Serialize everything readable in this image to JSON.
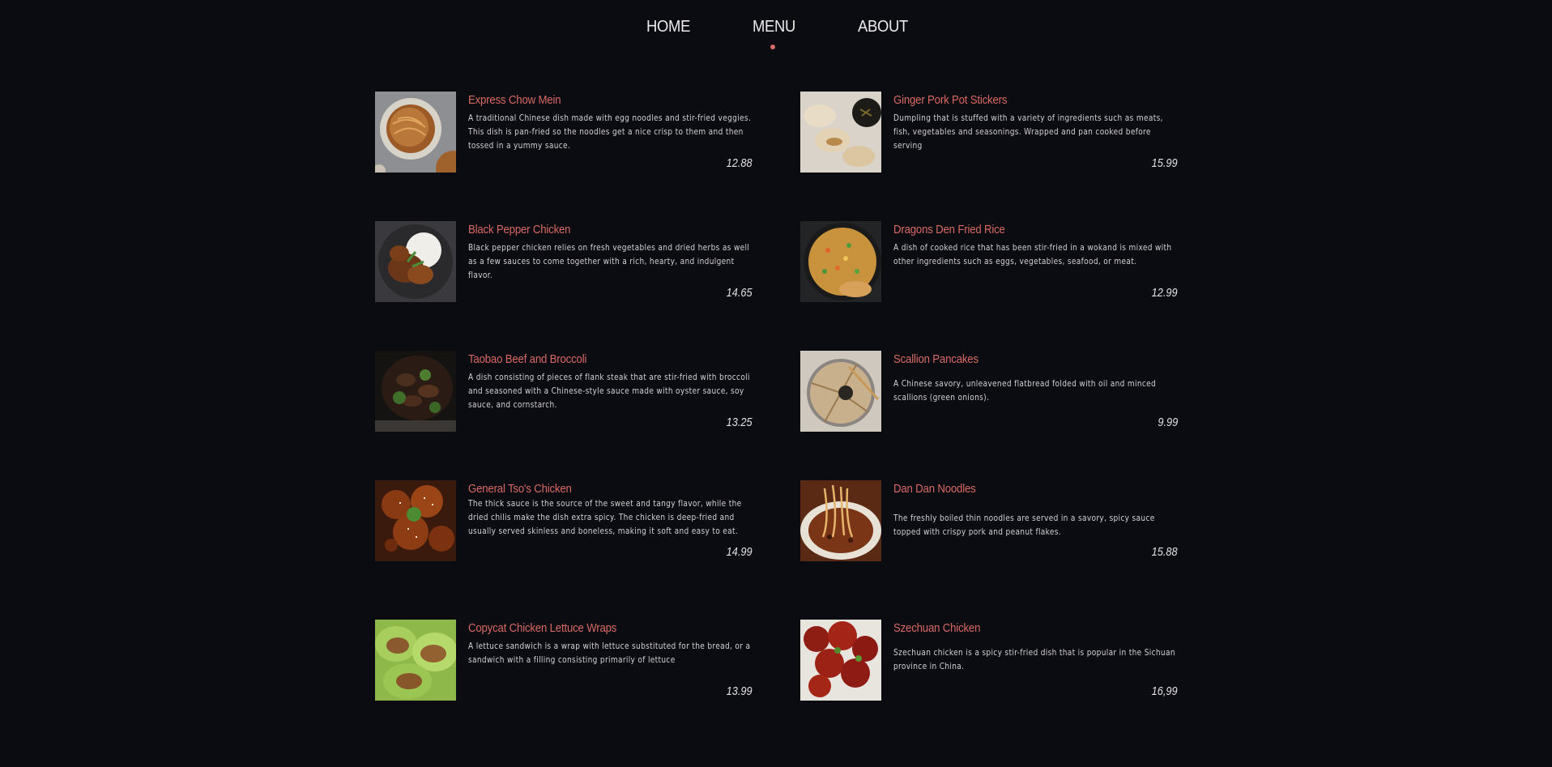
{
  "nav": {
    "home": "HOME",
    "menu": "MENU",
    "about": "ABOUT",
    "active_color": "#d86a64"
  },
  "menu": {
    "left": [
      {
        "title": "Express Chow Mein",
        "description": "A traditional Chinese dish made with egg noodles and stir-fried veggies. This dish is pan-fried so the noodles get a nice crisp to them and then tossed in a yummy sauce.",
        "price": "12.88",
        "image": "chow-mein-photo"
      },
      {
        "title": "Black Pepper Chicken",
        "description": "Black pepper chicken relies on fresh vegetables and dried herbs as well as a few sauces to come together with a rich, hearty, and indulgent flavor.",
        "price": "14.65",
        "image": "black-pepper-chicken-photo"
      },
      {
        "title": "Taobao Beef and Broccoli",
        "description": "A dish consisting of pieces of flank steak that are stir-fried with broccoli and seasoned with a Chinese-style sauce made with oyster sauce, soy sauce, and cornstarch.",
        "price": "13.25",
        "image": "beef-broccoli-photo"
      },
      {
        "title": "General Tso's Chicken",
        "description": "The thick sauce is the source of the sweet and tangy flavor, while the dried chilis make the dish extra spicy. The chicken is deep-fried and usually served skinless and boneless, making it soft and easy to eat.",
        "price": "14.99",
        "image": "general-tso-chicken-photo"
      },
      {
        "title": "Copycat Chicken Lettuce Wraps",
        "description": "A lettuce sandwich is a wrap with lettuce substituted for the bread, or a sandwich with a filling consisting primarily of lettuce",
        "price": "13.99",
        "image": "lettuce-wraps-photo"
      }
    ],
    "right": [
      {
        "title": "Ginger Pork Pot Stickers",
        "description": "Dumpling that is stuffed with a variety of ingredients such as meats, fish, vegetables and seasonings. Wrapped and pan cooked before serving",
        "price": "15.99",
        "image": "pot-stickers-photo"
      },
      {
        "title": "Dragons Den Fried Rice",
        "description": "A dish of cooked rice that has been stir-fried in a wokand is mixed with other ingredients such as eggs, vegetables, seafood, or meat.",
        "price": "12.99",
        "image": "fried-rice-photo"
      },
      {
        "title": "Scallion Pancakes",
        "description": "A Chinese savory, unleavened flatbread folded with oil and minced scallions (green onions).",
        "price": "9.99",
        "image": "scallion-pancakes-photo"
      },
      {
        "title": "Dan Dan Noodles",
        "description": "The freshly boiled thin noodles are served in a savory, spicy sauce topped with crispy pork and peanut flakes.",
        "price": "15.88",
        "image": "dan-dan-noodles-photo"
      },
      {
        "title": "Szechuan Chicken",
        "description": "Szechuan chicken is a spicy stir-fried dish that is popular in the Sichuan province in China.",
        "price": "16,99",
        "image": "szechuan-chicken-photo"
      }
    ]
  }
}
